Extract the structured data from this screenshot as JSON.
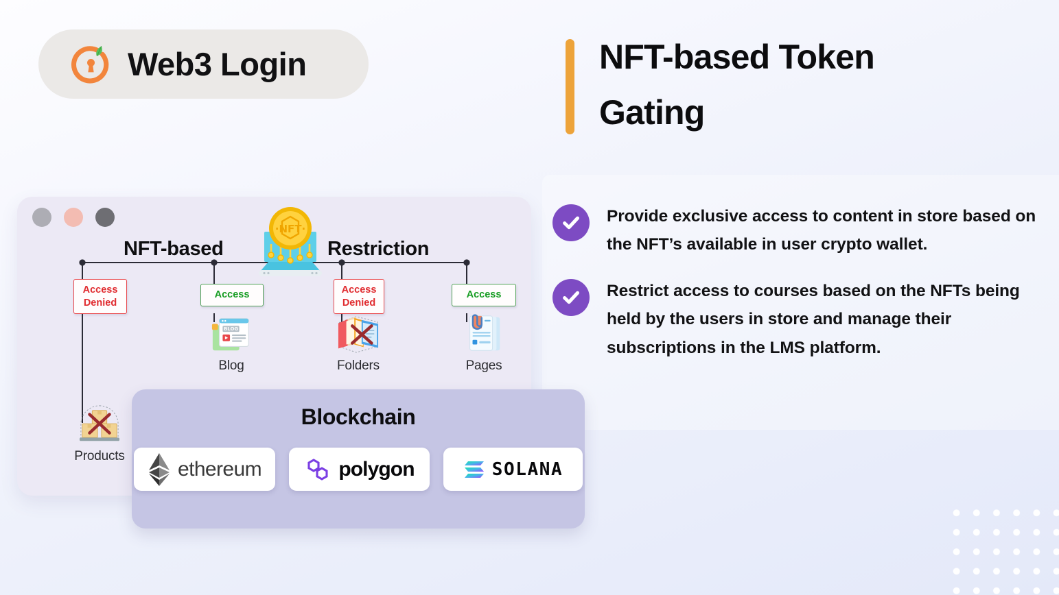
{
  "brand": {
    "name": "Web3 Login",
    "logo_icon": "lock-ring-leaf-icon"
  },
  "headline": {
    "text": "NFT-based Token Gating",
    "accent_color": "#eda33a"
  },
  "bullets": [
    {
      "icon": "check-circle-icon",
      "text": "Provide exclusive access to content in store based on the NFT’s available in user crypto wallet."
    },
    {
      "icon": "check-circle-icon",
      "text": "Restrict access to courses based on the NFTs being held by the users in store and manage their subscriptions in the LMS platform."
    }
  ],
  "bullet_color": "#7d4bc3",
  "mockup": {
    "window_dots": [
      "#adadb4",
      "#f3bcb2",
      "#6e6e73"
    ],
    "headings": {
      "left": "NFT-based",
      "right": "Restriction"
    },
    "center_graphic": {
      "icon": "nft-coin-chip-icon",
      "coin_label": "NFT"
    },
    "nodes": [
      {
        "status": "Access Denied",
        "status_type": "denied",
        "label": "Products",
        "icon": "boxes-blocked-icon"
      },
      {
        "status": "Access",
        "status_type": "allowed",
        "label": "Blog",
        "icon": "blog-window-icon",
        "icon_text": "BLOG"
      },
      {
        "status": "Access Denied",
        "status_type": "denied",
        "label": "Folders",
        "icon": "folders-blocked-icon"
      },
      {
        "status": "Access",
        "status_type": "allowed",
        "label": "Pages",
        "icon": "pages-paperclip-icon"
      }
    ],
    "status_denied_color": "#e02b2f",
    "status_allowed_color": "#169c22"
  },
  "blockchain": {
    "title": "Blockchain",
    "chains": [
      {
        "name": "ethereum",
        "icon": "ethereum-diamond-icon"
      },
      {
        "name": "polygon",
        "icon": "polygon-loops-icon"
      },
      {
        "name": "SOLANA",
        "icon": "solana-bars-icon"
      }
    ]
  }
}
